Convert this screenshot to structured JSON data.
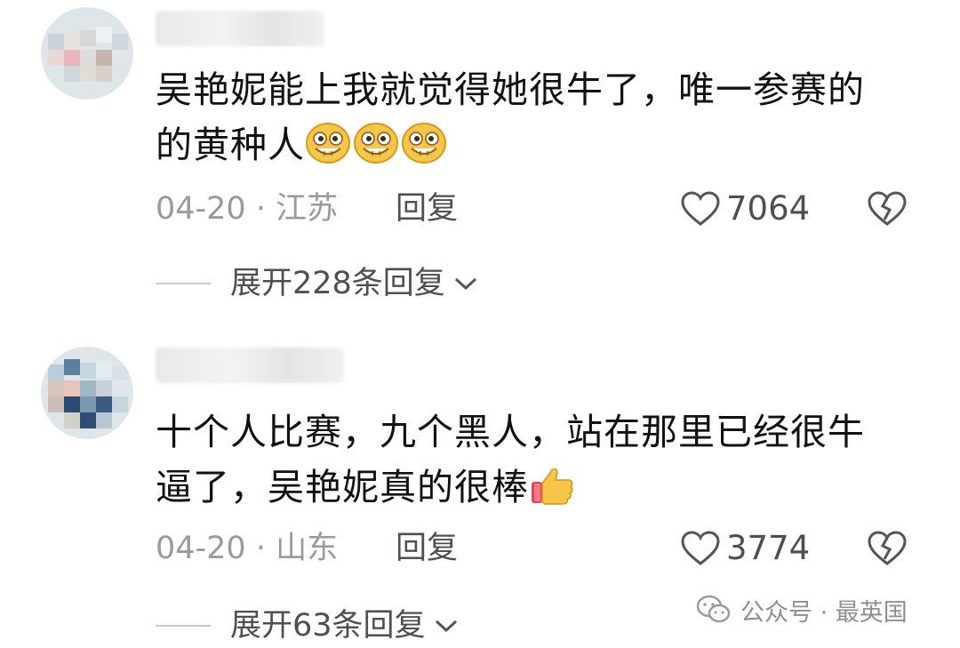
{
  "comments": [
    {
      "text_line1": "吴艳妮能上我就觉得她很牛了，唯一参赛的",
      "text_line2": "的黄种人",
      "emoji": [
        "grinning-face-emoji",
        "grinning-face-emoji",
        "grinning-face-emoji"
      ],
      "date_location": "04-20 · 江苏",
      "reply_label": "回复",
      "likes": "7064",
      "expand_label": "展开228条回复"
    },
    {
      "text_line1": "十个人比赛，九个黑人，站在那里已经很牛",
      "text_line2": "逼了，吴艳妮真的很棒",
      "emoji": [
        "thumbs-up-emoji"
      ],
      "date_location": "04-20 · 山东",
      "reply_label": "回复",
      "likes": "3774",
      "expand_label": "展开63条回复"
    }
  ],
  "watermark": {
    "text": "公众号 · 最英国"
  },
  "colors": {
    "text": "#111111",
    "meta_gray": "#9a9a9a",
    "action_gray": "#4f4f4f"
  }
}
